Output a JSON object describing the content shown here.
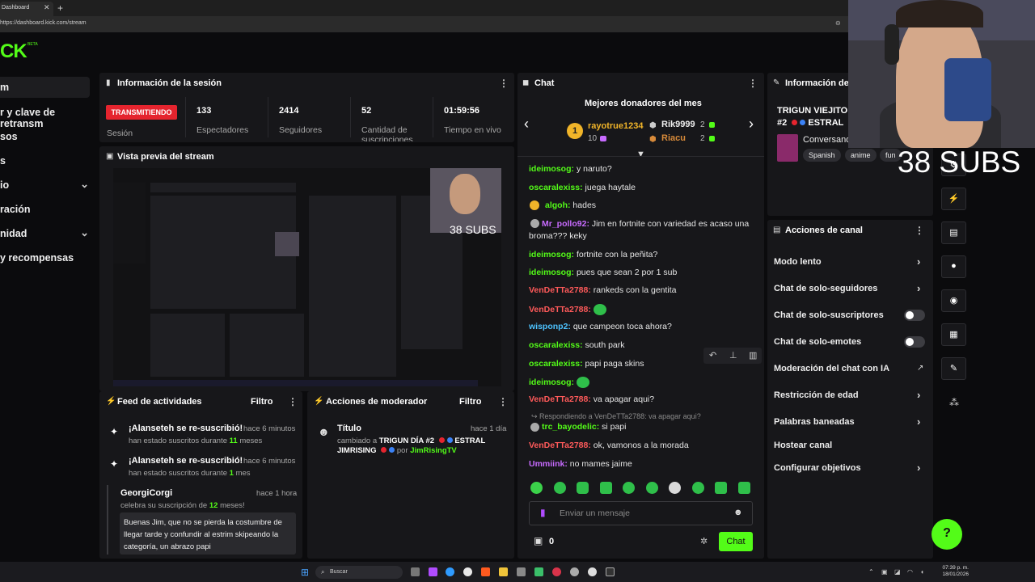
{
  "browser": {
    "tab_title": "Dashboard",
    "url": "https://dashboard.kick.com/stream"
  },
  "logo": {
    "text": "CK",
    "beta": "BETA"
  },
  "sidebar": {
    "items": [
      {
        "label": "m"
      },
      {
        "label": "r y clave de retransm"
      },
      {
        "label": "sos"
      },
      {
        "label": "s"
      },
      {
        "label": "io"
      },
      {
        "label": "ración"
      },
      {
        "label": "nidad"
      },
      {
        "label": "y recompensas"
      }
    ]
  },
  "session": {
    "title": "Información de la sesión",
    "status": "TRANSMITIENDO",
    "status_label": "Sesión",
    "stats": [
      {
        "value": "133",
        "label": "Espectadores"
      },
      {
        "value": "2414",
        "label": "Seguidores"
      },
      {
        "value": "52",
        "label": "Cantidad de suscripciones"
      },
      {
        "value": "01:59:56",
        "label": "Tiempo en vivo"
      }
    ]
  },
  "preview": {
    "title": "Vista previa del stream",
    "subs_overlay": "38 SUBS"
  },
  "activity": {
    "title": "Feed de actividades",
    "filter": "Filtro",
    "items": [
      {
        "title": "¡Alanseteh se re-suscribió!",
        "time": "hace 6 minutos",
        "sub_a": "han estado suscritos durante",
        "sub_b": "11",
        "sub_c": "meses"
      },
      {
        "title": "¡Alanseteh se re-suscribió!",
        "time": "hace 6 minutos",
        "sub_a": "han estado suscritos durante",
        "sub_b": "1",
        "sub_c": "mes"
      }
    ],
    "gift": {
      "user": "GeorgiCorgi",
      "time": "hace 1 hora",
      "sub_a": "celebra su suscripción de",
      "sub_b": "12",
      "sub_c": "meses!",
      "message": "Buenas Jim, que no se pierda la costumbre de llegar tarde y confundir al estrim skipeando la categoría, un abrazo papi"
    }
  },
  "modactions": {
    "title": "Acciones de moderador",
    "filter": "Filtro",
    "item": {
      "title": "Título",
      "time": "hace 1 día",
      "line1_a": "cambiado a",
      "line1_b": "TRIGUN DÍA #2",
      "line1_c": "ESTRAL",
      "line2_a": "JIMRISING",
      "line2_b": "por",
      "line2_c": "JimRisingTV"
    }
  },
  "chat": {
    "title": "Chat",
    "donors_title": "Mejores donadores del mes",
    "donors": [
      {
        "rank": "1",
        "name": "rayotrue1234",
        "amount": "10"
      },
      {
        "name": "Rik9999",
        "amount": "2"
      },
      {
        "name": "Riacu",
        "amount": "2"
      }
    ],
    "messages": [
      {
        "user": "ideimosog",
        "color": "#53fc18",
        "text": "y naruto?"
      },
      {
        "user": "oscaralexiss",
        "color": "#53fc18",
        "text": "juega haytale"
      },
      {
        "user": "algoh",
        "color": "#53fc18",
        "text": "hades"
      },
      {
        "user": "Mr_pollo92",
        "color": "#c86bff",
        "text": "Jim en fortnite con variedad es acaso una"
      },
      {
        "user": "",
        "color": "#e6e6e6",
        "text": "broma??? keky"
      },
      {
        "user": "ideimosog",
        "color": "#53fc18",
        "text": "fortnite con la peñita?"
      },
      {
        "user": "ideimosog",
        "color": "#53fc18",
        "text": "pues que sean 2 por 1 sub"
      },
      {
        "user": "VenDeTTa2788",
        "color": "#ff5a5a",
        "text": "rankeds con la gentita"
      },
      {
        "user": "VenDeTTa2788",
        "color": "#ff5a5a",
        "text": ""
      },
      {
        "user": "wisponp2",
        "color": "#4dc3ff",
        "text": "que campeon toca ahora?"
      },
      {
        "user": "oscaralexiss",
        "color": "#53fc18",
        "text": "south park"
      },
      {
        "user": "oscaralexiss",
        "color": "#53fc18",
        "text": "papi paga skins"
      },
      {
        "user": "ideimosog",
        "color": "#53fc18",
        "text": ""
      },
      {
        "user": "VenDeTTa2788",
        "color": "#ff5a5a",
        "text": "va apagar aqui?"
      },
      {
        "user": "",
        "color": "#8a8a8a",
        "text": "↪ Respondiendo a VenDeTTa2788: va apagar aqui?"
      },
      {
        "user": "trc_bayodelic",
        "color": "#53fc18",
        "text": "si papi"
      },
      {
        "user": "VenDeTTa2788",
        "color": "#ff5a5a",
        "text": "ok, vamonos a la morada"
      },
      {
        "user": "Ummiink",
        "color": "#c86bff",
        "text": "no mames jaime"
      }
    ],
    "placeholder": "Enviar un mensaje",
    "points": "0",
    "send": "Chat"
  },
  "info": {
    "title": "Información de",
    "stream_title_a": "TRIGUN VIEJITO",
    "stream_title_b": "#2",
    "stream_title_c": "ESTRAL",
    "category": "Conversando",
    "tags": [
      "Spanish",
      "anime",
      "fun"
    ]
  },
  "channel_actions": {
    "title": "Acciones de canal",
    "items": [
      {
        "label": "Modo lento",
        "kind": "chevron"
      },
      {
        "label": "Chat de solo-seguidores",
        "kind": "chevron"
      },
      {
        "label": "Chat de solo-suscriptores",
        "kind": "toggle",
        "on": false
      },
      {
        "label": "Chat de solo-emotes",
        "kind": "toggle",
        "on": false
      },
      {
        "label": "Moderación del chat con IA",
        "kind": "external"
      },
      {
        "label": "Restricción de edad",
        "kind": "chevron"
      },
      {
        "label": "Palabras baneadas",
        "kind": "chevron"
      },
      {
        "label": "Hostear canal",
        "kind": "none"
      },
      {
        "label": "Configurar objetivos",
        "kind": "chevron"
      }
    ]
  },
  "overlay": {
    "subs": "38 SUBS"
  },
  "taskbar": {
    "search": "Buscar",
    "time": "07:39 p. m.",
    "date": "18/01/2026"
  },
  "colors": {
    "accent": "#53fc18",
    "live": "#e5242e",
    "panel": "#17171a",
    "bg": "#0b0b0d"
  }
}
